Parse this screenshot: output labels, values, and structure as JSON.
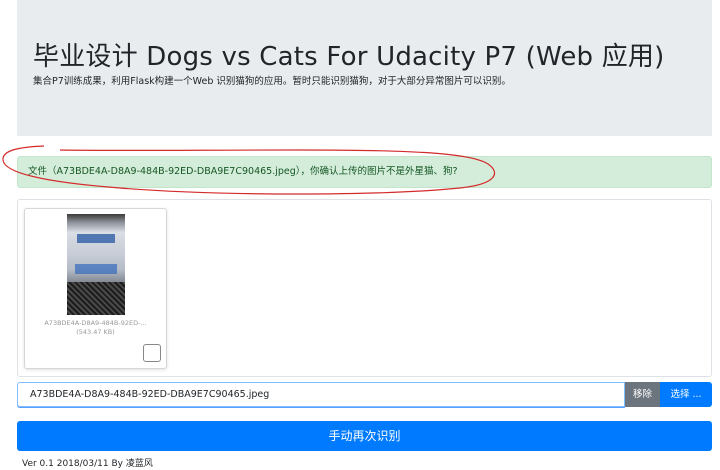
{
  "header": {
    "title": "毕业设计 Dogs vs Cats For Udacity P7 (Web 应用)",
    "subtitle": "集合P7训练成果，利用Flask构建一个Web 识别猫狗的应用。暂时只能识别猫狗，对于大部分异常图片可以识别。"
  },
  "alert": {
    "message": "文件（A73BDE4A-D8A9-484B-92ED-DBA9E7C90465.jpeg），你确认上传的图片不是外星猫、狗?"
  },
  "preview": {
    "file_name": "A73BDE4A-D8A9-484B-92ED-...",
    "file_size": "(543.47 KB)"
  },
  "file_input": {
    "value": "A73BDE4A-D8A9-484B-92ED-DBA9E7C90465.jpeg",
    "remove_label": "移除",
    "browse_label": "选择 ..."
  },
  "actions": {
    "recognize_label": "手动再次识别"
  },
  "footer": {
    "text": "Ver 0.1 2018/03/11 By 凌蓝风"
  },
  "colors": {
    "primary": "#007bff",
    "secondary": "#6c757d",
    "alert_bg": "#d4edda",
    "alert_text": "#155724",
    "jumbotron_bg": "#e9ecef",
    "annotation": "#d42a2a"
  }
}
